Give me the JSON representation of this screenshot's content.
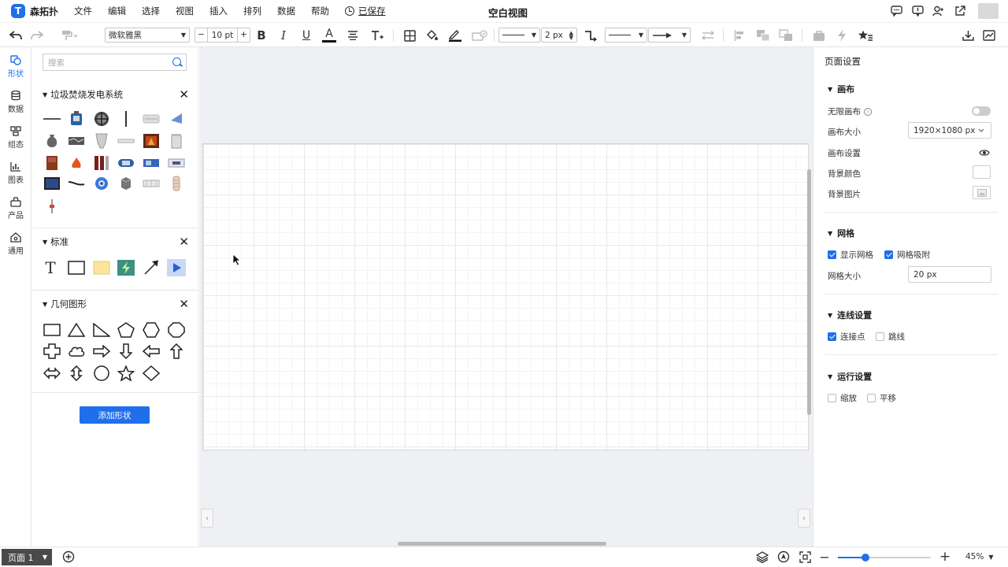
{
  "app": {
    "logo_letter": "T",
    "name": "森拓扑"
  },
  "menu": [
    "文件",
    "编辑",
    "选择",
    "视图",
    "插入",
    "排列",
    "数据",
    "帮助"
  ],
  "save_status": "已保存",
  "document_title": "空白视图",
  "toolbar": {
    "font_family": "微软雅黑",
    "font_size": "10 pt",
    "font_size_minus": "−",
    "font_size_plus": "+",
    "bold": "B",
    "italic": "I",
    "underline": "U",
    "font_color": "A",
    "line_width": "2 px"
  },
  "rail": [
    {
      "label": "形状",
      "icon": "shapes-icon"
    },
    {
      "label": "数据",
      "icon": "database-icon"
    },
    {
      "label": "组态",
      "icon": "config-icon"
    },
    {
      "label": "图表",
      "icon": "chart-icon"
    },
    {
      "label": "产品",
      "icon": "product-icon"
    },
    {
      "label": "通用",
      "icon": "general-icon"
    }
  ],
  "shapes_panel": {
    "search_placeholder": "搜索",
    "libraries": [
      {
        "title": "垃圾焚烧发电系统"
      },
      {
        "title": "标准",
        "text_glyph": "T"
      },
      {
        "title": "几何图形"
      }
    ],
    "add_shape_label": "添加形状"
  },
  "properties": {
    "title": "页面设置",
    "canvas": {
      "section": "画布",
      "infinite_canvas_label": "无限画布",
      "infinite_canvas_on": false,
      "canvas_size_label": "画布大小",
      "canvas_size_value": "1920×1080 px",
      "canvas_settings_label": "画布设置",
      "bg_color_label": "背景颜色",
      "bg_image_label": "背景图片"
    },
    "grid": {
      "section": "网格",
      "show_grid": "显示网格",
      "show_grid_checked": true,
      "snap_grid": "网格吸附",
      "snap_grid_checked": true,
      "grid_size_label": "网格大小",
      "grid_size_value": "20 px"
    },
    "connection": {
      "section": "连线设置",
      "connect_points": "连接点",
      "connect_points_checked": true,
      "jump_line": "跳线",
      "jump_line_checked": false
    },
    "runtime": {
      "section": "运行设置",
      "zoom": "缩放",
      "zoom_checked": false,
      "pan": "平移",
      "pan_checked": false
    }
  },
  "status_bar": {
    "page_tab": "页面 1",
    "zoom_minus": "−",
    "zoom_plus": "+",
    "zoom_level": 45,
    "zoom_label": "45%"
  },
  "colors": {
    "accent": "#1f6feb",
    "canvas_bg": "#eef0f3",
    "page_tab_bg": "#4a4a4a"
  }
}
